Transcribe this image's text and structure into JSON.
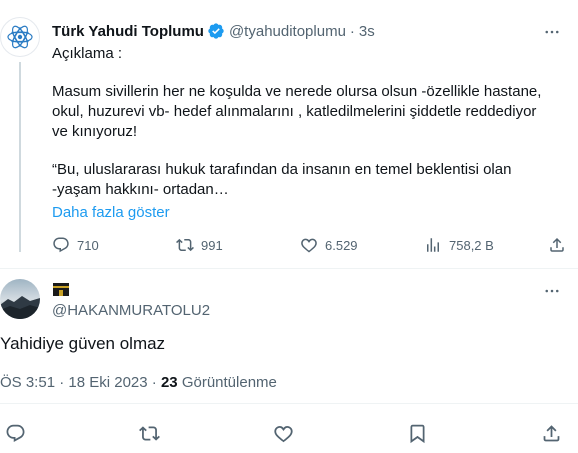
{
  "quoted": {
    "name": "Türk Yahudi Toplumu",
    "handle": "@tyahuditoplumu",
    "separator": "·",
    "time": "3s",
    "body": [
      "Açıklama :",
      "Masum sivillerin her ne koşulda ve nerede olursa olsun -özellikle hastane,\nokul, huzurevi vb- hedef alınmalarını , katledilmelerini şiddetle reddediyor\nve kınıyoruz!",
      "“Bu, uluslararası hukuk tarafından da insanın en temel beklentisi olan\n-yaşam hakkını- ortadan…"
    ],
    "show_more": "Daha fazla göster",
    "actions": {
      "replies": "710",
      "reposts": "991",
      "likes": "6.529",
      "views": "758,2 B"
    }
  },
  "reply": {
    "handle": "@HAKANMURATOLU2",
    "text": "Yahidiye güven olmaz",
    "time": "ÖS 3:51",
    "date": "18 Eki 2023",
    "separator": "·",
    "views_count": "23",
    "views_label": "Görüntülenme"
  },
  "colors": {
    "accent": "#1d9bf0",
    "muted": "#536471",
    "text": "#0f1419",
    "divider": "#eff3f4"
  },
  "icons": [
    "logo-icon",
    "verified-icon",
    "more-icon",
    "reply-icon",
    "repost-icon",
    "like-icon",
    "views-icon",
    "share-icon",
    "bookmark-icon",
    "kaaba-icon"
  ]
}
